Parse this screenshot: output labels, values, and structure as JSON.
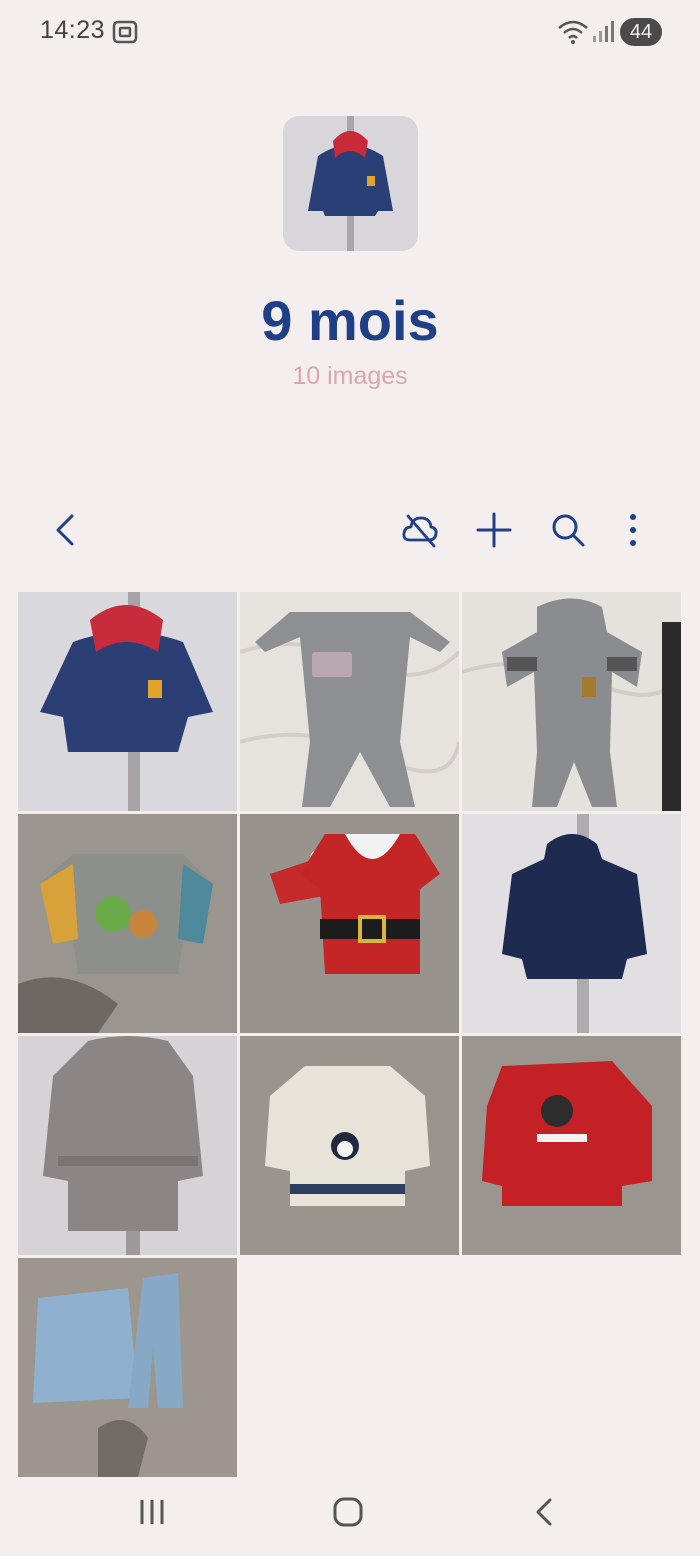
{
  "status_bar": {
    "time": "14:23",
    "battery": "44",
    "icons": [
      "screenshot-icon",
      "wifi-icon",
      "signal-icon"
    ]
  },
  "album": {
    "title": "9 mois",
    "count": "10 images",
    "cover_icon": "jacket-photo"
  },
  "toolbar": {
    "back_icon": "chevron-left-icon",
    "actions": [
      "cloud-off-icon",
      "plus-icon",
      "search-icon",
      "more-vertical-icon"
    ]
  },
  "photos": [
    {
      "subject": "denim hooded jacket with red lining"
    },
    {
      "subject": "grey bodysuit on bed"
    },
    {
      "subject": "grey hooded bodysuit with giraffe"
    },
    {
      "subject": "grey striped-sleeve sweater"
    },
    {
      "subject": "red santa costume with hat"
    },
    {
      "subject": "navy fleece hooded jacket"
    },
    {
      "subject": "grey bathrobe"
    },
    {
      "subject": "cream knit sweater with penguin"
    },
    {
      "subject": "red ho ho ho sweater"
    },
    {
      "subject": "denim jacket and jeans set"
    }
  ],
  "colors": {
    "background": "#f4eeee",
    "accent": "#1f3f86",
    "subtle_text": "#d9a7ad"
  },
  "navigation": [
    "recent-apps-icon",
    "home-icon",
    "back-icon"
  ]
}
